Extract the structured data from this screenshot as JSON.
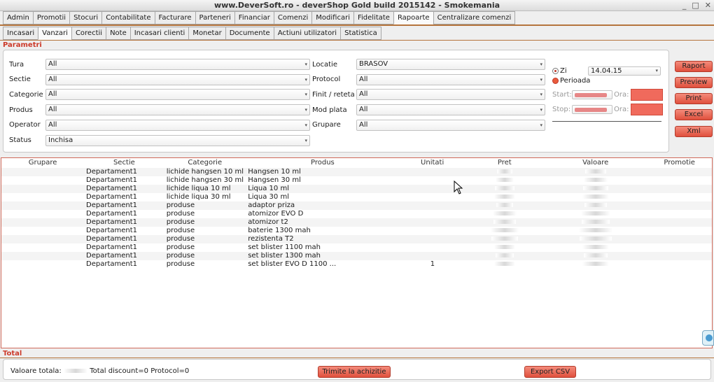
{
  "window": {
    "title": "www.DeverSoft.ro - deverShop Gold        build 2015142 - Smokemania",
    "controls": [
      "_",
      "□",
      "✕"
    ]
  },
  "main_tabs": [
    "Admin",
    "Promotii",
    "Stocuri",
    "Contabilitate",
    "Facturare",
    "Parteneri",
    "Financiar",
    "Comenzi",
    "Modificari",
    "Fidelitate",
    "Rapoarte",
    "Centralizare comenzi"
  ],
  "main_active": "Rapoarte",
  "sub_tabs": [
    "Incasari",
    "Vanzari",
    "Corectii",
    "Note",
    "Incasari clienti",
    "Monetar",
    "Documente",
    "Actiuni utilizatori",
    "Statistica"
  ],
  "sub_active": "Vanzari",
  "params": {
    "section_label": "Parametri",
    "left_fields": [
      {
        "label": "Tura",
        "value": "All"
      },
      {
        "label": "Sectie",
        "value": "All"
      },
      {
        "label": "Categorie",
        "value": "All"
      },
      {
        "label": "Produs",
        "value": "All"
      },
      {
        "label": "Operator",
        "value": "All"
      },
      {
        "label": "Status",
        "value": "Inchisa"
      }
    ],
    "right_fields": [
      {
        "label": "Locatie",
        "value": "BRASOV"
      },
      {
        "label": "Protocol",
        "value": "All"
      },
      {
        "label": "Finit / reteta",
        "value": "All"
      },
      {
        "label": "Mod plata",
        "value": "All"
      },
      {
        "label": "Grupare",
        "value": "All"
      }
    ],
    "period": {
      "zi_label": "Zi",
      "zi_value": "14.04.15",
      "perioada_label": "Perioada",
      "start_label": "Start:",
      "stop_label": "Stop:",
      "ora_label": "Ora:"
    }
  },
  "actions": [
    "Raport",
    "Preview",
    "Print",
    "Excel",
    "Xml"
  ],
  "grid": {
    "headers": [
      "Grupare",
      "Sectie",
      "Categorie",
      "Produs",
      "Unitati",
      "Pret",
      "Valoare",
      "Promotie"
    ],
    "rows": [
      {
        "sectie": "Departament1",
        "categorie": "lichide hangsen 10 ml",
        "produs": "Hangsen 10 ml",
        "unitati": ""
      },
      {
        "sectie": "Departament1",
        "categorie": "lichide hangsen 30 ml",
        "produs": "Hangsen 30 ml",
        "unitati": ""
      },
      {
        "sectie": "Departament1",
        "categorie": "lichide liqua 10 ml",
        "produs": "Liqua 10 ml",
        "unitati": ""
      },
      {
        "sectie": "Departament1",
        "categorie": "lichide liqua 30 ml",
        "produs": "Liqua 30 ml",
        "unitati": ""
      },
      {
        "sectie": "Departament1",
        "categorie": "produse",
        "produs": "adaptor priza",
        "unitati": ""
      },
      {
        "sectie": "Departament1",
        "categorie": "produse",
        "produs": "atomizor EVO D",
        "unitati": ""
      },
      {
        "sectie": "Departament1",
        "categorie": "produse",
        "produs": "atomizor t2",
        "unitati": ""
      },
      {
        "sectie": "Departament1",
        "categorie": "produse",
        "produs": "baterie 1300 mah",
        "unitati": ""
      },
      {
        "sectie": "Departament1",
        "categorie": "produse",
        "produs": "rezistenta T2",
        "unitati": ""
      },
      {
        "sectie": "Departament1",
        "categorie": "produse",
        "produs": "set blister 1100 mah",
        "unitati": ""
      },
      {
        "sectie": "Departament1",
        "categorie": "produse",
        "produs": "set blister 1300 mah",
        "unitati": ""
      },
      {
        "sectie": "Departament1",
        "categorie": "produse",
        "produs": "set blister EVO D 1100 ...",
        "unitati": "1"
      }
    ]
  },
  "total": {
    "section_label": "Total",
    "valoare_label": "Valoare totala:",
    "summary": "Total discount=0 Protocol=0",
    "send_button": "Trimite la achizitie",
    "export_button": "Export CSV"
  },
  "colors": {
    "accent_red": "#e0503d",
    "label_red": "#cc3a2a",
    "divider": "#b5743c"
  }
}
